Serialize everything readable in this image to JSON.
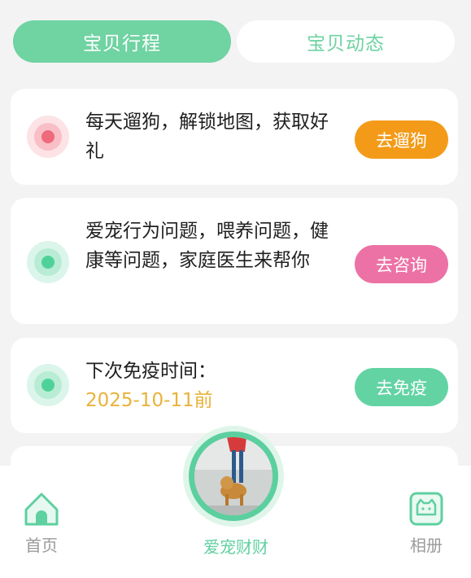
{
  "tabs": {
    "active_label": "宝贝行程",
    "inactive_label": "宝贝动态"
  },
  "cards": [
    {
      "text": "每天遛狗，解锁地图，获取好礼",
      "button_label": "去遛狗",
      "accent": "#f39b18"
    },
    {
      "text": "爱宠行为问题，喂养问题，健康等问题，家庭医生来帮你",
      "button_label": "去咨询",
      "accent": "#ec72a5"
    },
    {
      "text": "下次免疫时间：",
      "date": "2025-10-11前",
      "button_label": "去免疫",
      "accent": "#63d3a4"
    }
  ],
  "bottom_nav": {
    "home_label": "首页",
    "center_label": "爱宠财财",
    "album_label": "相册",
    "home_icon": "home-icon",
    "album_icon": "album-cat-icon"
  },
  "colors": {
    "primary": "#6fd3a2",
    "date": "#e9b23a"
  }
}
